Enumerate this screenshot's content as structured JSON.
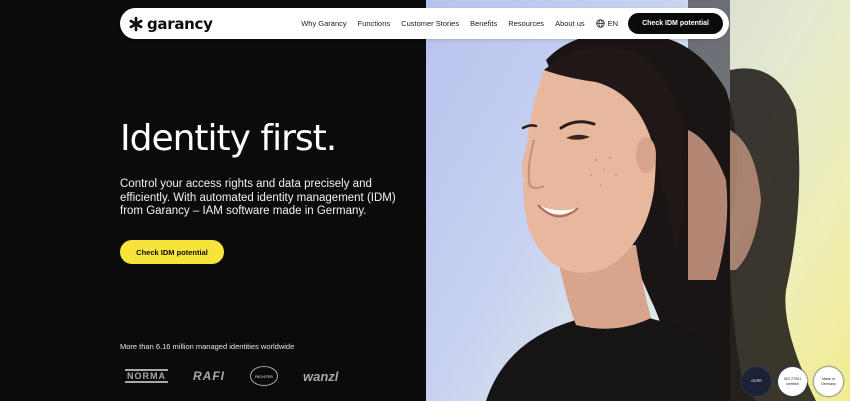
{
  "brand": {
    "name": "garancy"
  },
  "nav": {
    "items": [
      "Why Garancy",
      "Functions",
      "Customer Stories",
      "Benefits",
      "Resources",
      "About us"
    ],
    "language": "EN",
    "cta": "Check IDM potential"
  },
  "hero": {
    "title": "Identity first.",
    "lead": "Control your access rights and data precisely and efficiently. With automated identity management (IDM) from Garancy – IAM software made in Germany.",
    "cta": "Check IDM potential"
  },
  "trust": {
    "stat": "More than 6.16 million managed identities worldwide",
    "logos": [
      "NORMA",
      "RAFI",
      "RICHTER",
      "wanzl"
    ]
  },
  "badges": [
    "GDPR",
    "ISO 27001 certified",
    "Made in Germany"
  ],
  "colors": {
    "accent": "#f7e43a",
    "background": "#0b0b0c"
  }
}
